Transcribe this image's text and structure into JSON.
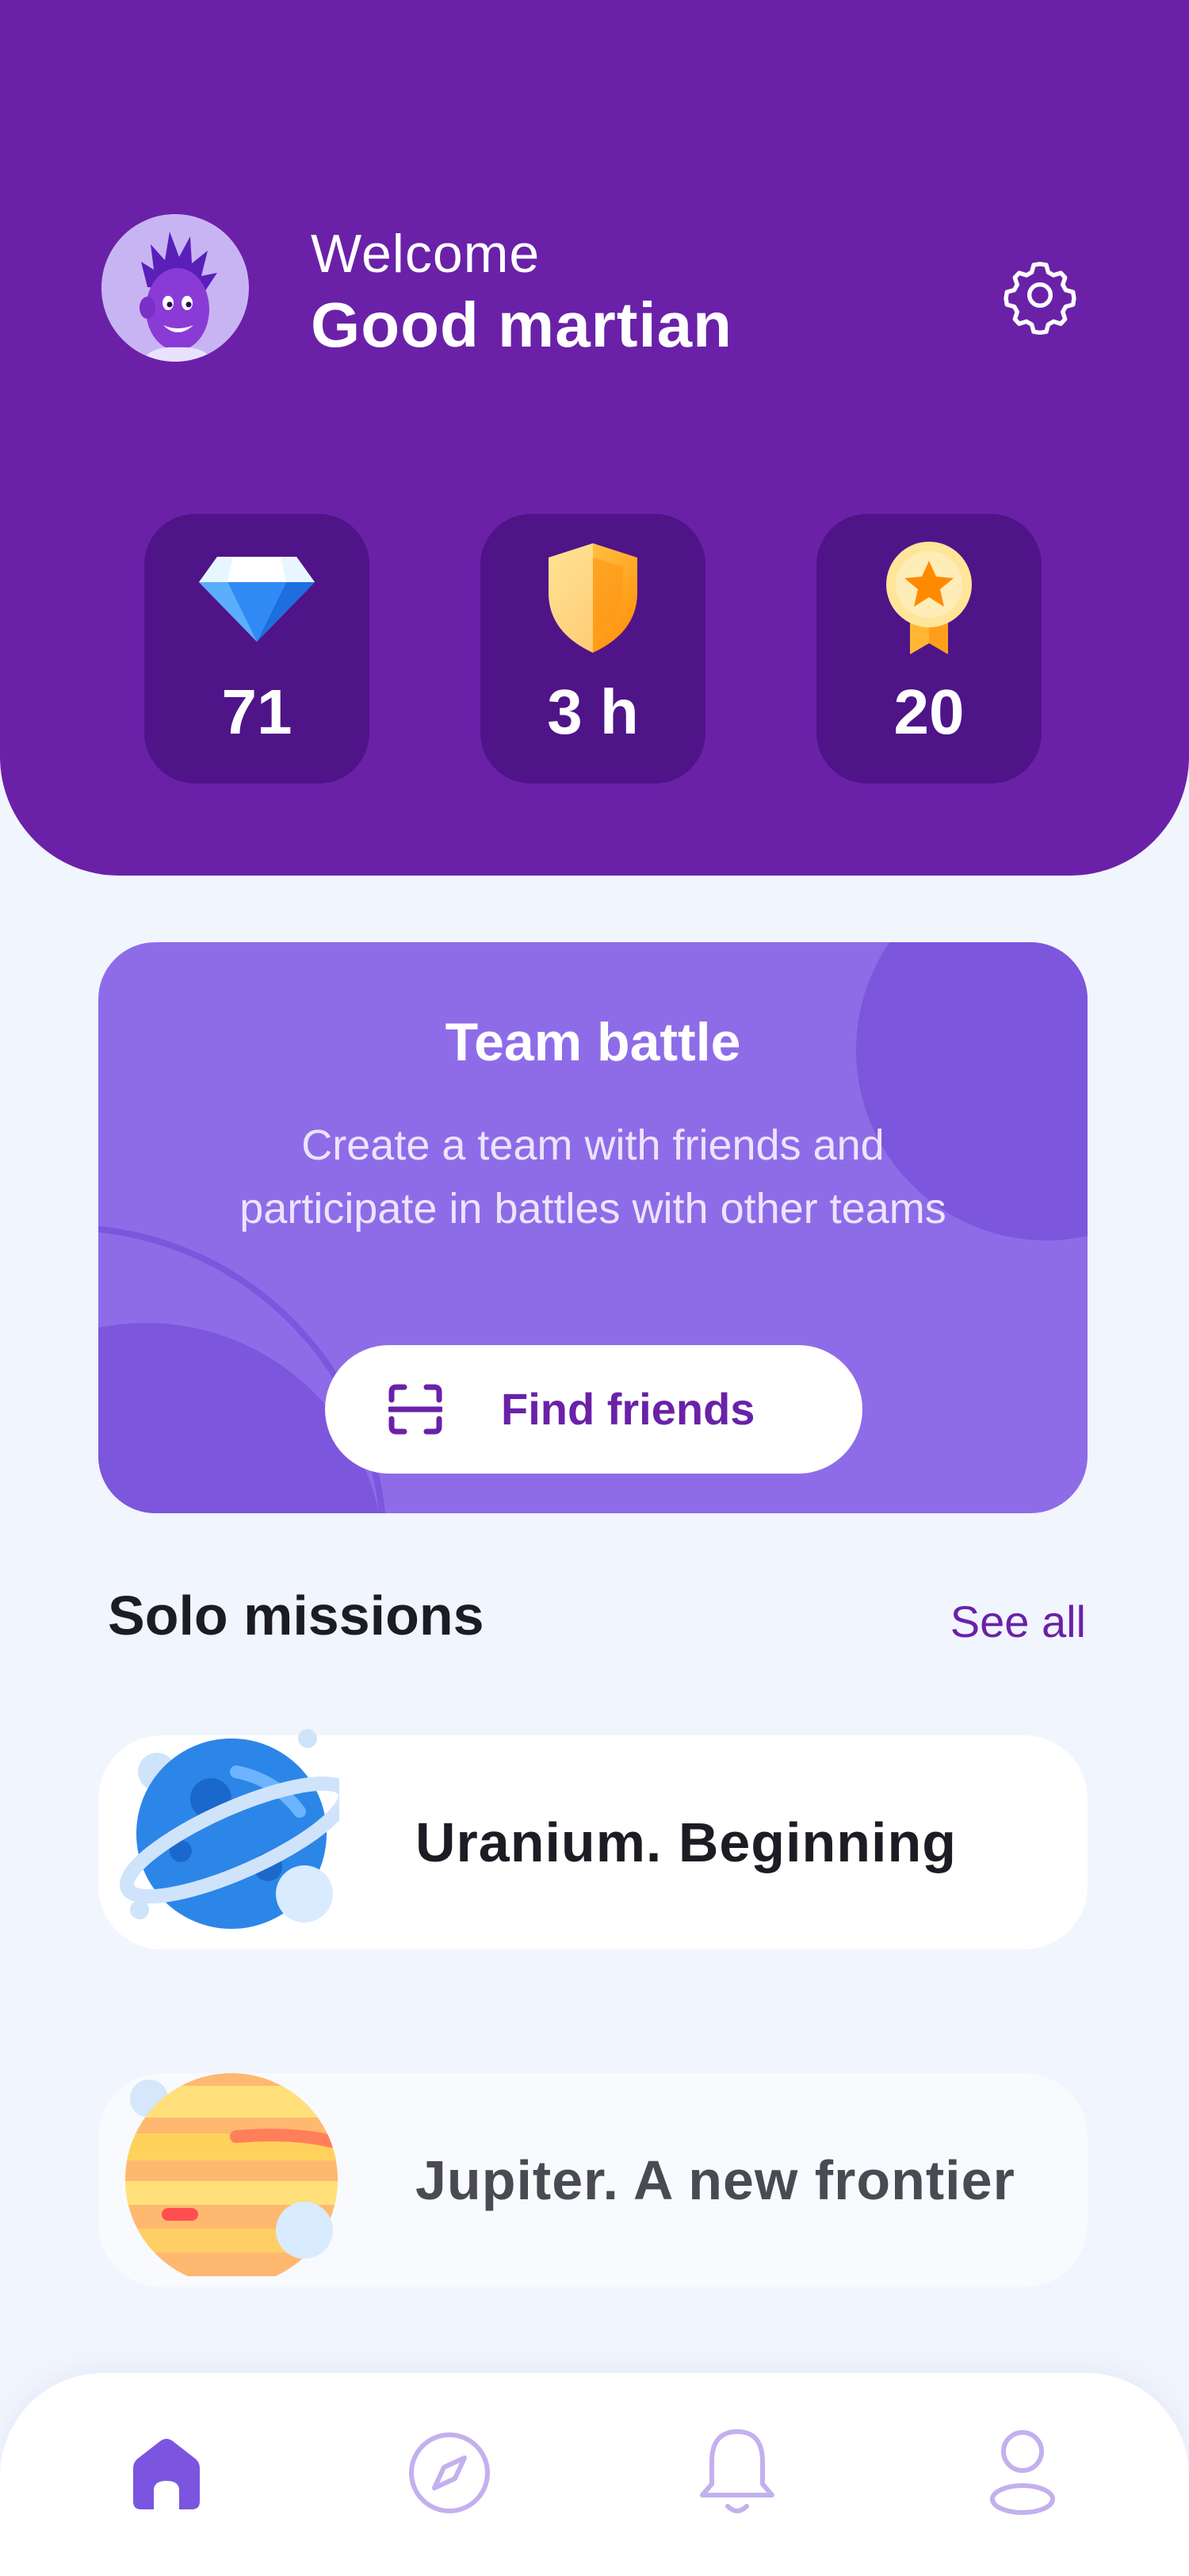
{
  "header": {
    "welcome": "Welcome",
    "user_name": "Good martian",
    "avatar_icon": "martian-avatar-icon",
    "settings_icon": "gear-icon",
    "background_color": "#6a21a8"
  },
  "stats": [
    {
      "icon": "diamond-icon",
      "value": "71"
    },
    {
      "icon": "shield-icon",
      "value": "3 h"
    },
    {
      "icon": "medal-icon",
      "value": "20"
    }
  ],
  "team_battle": {
    "title": "Team battle",
    "description": "Create a team with friends and\nparticipate in battles with other teams",
    "button_label": "Find friends",
    "button_icon": "scan-icon"
  },
  "solo_missions": {
    "title": "Solo missions",
    "see_all": "See all",
    "items": [
      {
        "label": "Uranium. Beginning",
        "icon": "blue-planet-icon"
      },
      {
        "label": "Jupiter. A new frontier",
        "icon": "jupiter-planet-icon"
      }
    ]
  },
  "nav": [
    {
      "name": "home",
      "icon": "home-icon",
      "active": true
    },
    {
      "name": "explore",
      "icon": "compass-icon",
      "active": false
    },
    {
      "name": "notifications",
      "icon": "bell-icon",
      "active": false
    },
    {
      "name": "profile",
      "icon": "user-icon",
      "active": false
    }
  ],
  "colors": {
    "accent": "#6a21a8",
    "card_purple": "#8e6ce8",
    "stat_card": "#4f1488",
    "page_background": "#f1f5fd"
  }
}
